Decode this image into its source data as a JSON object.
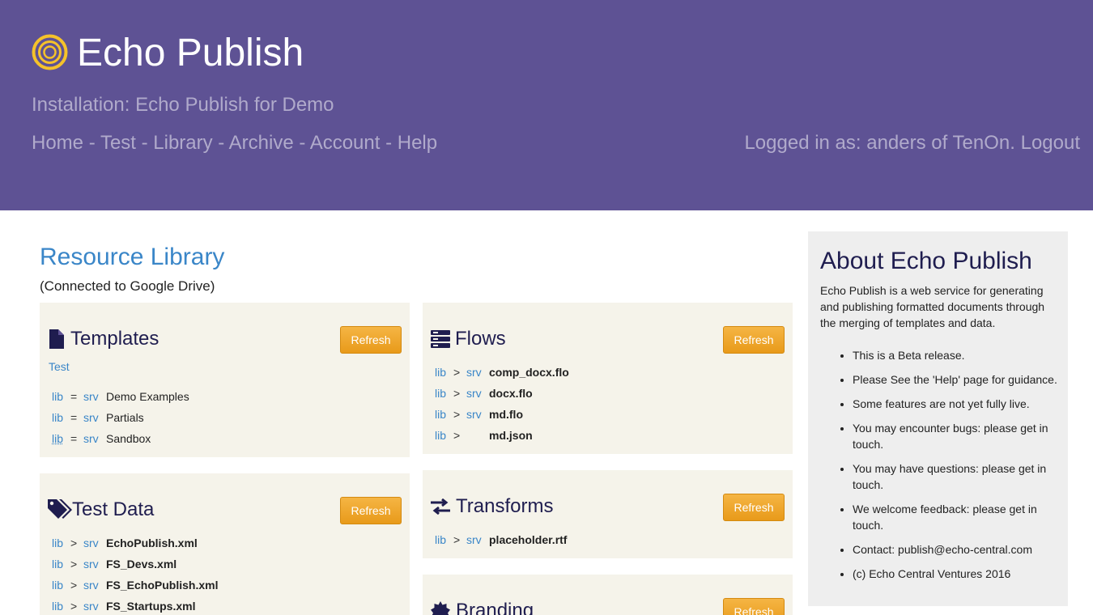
{
  "header": {
    "app_title": "Echo Publish",
    "installation": "Installation: Echo Publish for Demo",
    "nav": [
      "Home",
      "Test",
      "Library",
      "Archive",
      "Account",
      "Help"
    ],
    "nav_separator": " - ",
    "login_text": "Logged in as: anders of TenOn.",
    "logout_label": "Logout"
  },
  "library": {
    "title": "Resource Library",
    "subtitle": "(Connected to Google Drive)"
  },
  "refresh_label": "Refresh",
  "panels": {
    "templates": {
      "title": "Templates",
      "icon": "file-icon",
      "test_link": "Test",
      "rows": [
        {
          "a": "lib",
          "op": "=",
          "b": "srv",
          "name": "Demo Examples"
        },
        {
          "a": "lib",
          "op": "=",
          "b": "srv",
          "name": "Partials"
        },
        {
          "a": "lib",
          "op": "=",
          "b": "srv",
          "name": "Sandbox"
        }
      ]
    },
    "test_data": {
      "title": "Test Data",
      "icon": "tags-icon",
      "rows": [
        {
          "a": "lib",
          "op": ">",
          "b": "srv",
          "name": "EchoPublish.xml"
        },
        {
          "a": "lib",
          "op": ">",
          "b": "srv",
          "name": "FS_Devs.xml"
        },
        {
          "a": "lib",
          "op": ">",
          "b": "srv",
          "name": "FS_EchoPublish.xml"
        },
        {
          "a": "lib",
          "op": ">",
          "b": "srv",
          "name": "FS_Startups.xml"
        }
      ]
    },
    "flows": {
      "title": "Flows",
      "icon": "server-stack-icon",
      "rows": [
        {
          "a": "lib",
          "op": ">",
          "b": "srv",
          "name": "comp_docx.flo"
        },
        {
          "a": "lib",
          "op": ">",
          "b": "srv",
          "name": "docx.flo"
        },
        {
          "a": "lib",
          "op": ">",
          "b": "srv",
          "name": "md.flo"
        },
        {
          "a": "lib",
          "op": ">",
          "b": "",
          "name": "md.json"
        }
      ]
    },
    "transforms": {
      "title": "Transforms",
      "icon": "exchange-arrows-icon",
      "rows": [
        {
          "a": "lib",
          "op": ">",
          "b": "srv",
          "name": "placeholder.rtf"
        }
      ]
    },
    "branding": {
      "title": "Branding",
      "icon": "badge-icon"
    }
  },
  "about": {
    "title": "About Echo Publish",
    "description": "Echo Publish is a web service for generating and publishing formatted documents through the merging of templates and data.",
    "items": [
      "This is a Beta release.",
      "Please See the 'Help' page for guidance.",
      "Some features are not yet fully live.",
      "You may encounter bugs: please get in touch.",
      "You may have questions: please get in touch.",
      "We welcome feedback: please get in touch.",
      "Contact: publish@echo-central.com",
      "(c) Echo Central Ventures 2016"
    ]
  },
  "colors": {
    "header_bg": "#5e5294",
    "accent": "#3a86c8",
    "button": "#f0a830",
    "panel_bg": "#f5f3ea",
    "sidebar_bg": "#eeeeee",
    "logo": "#f5c22a"
  }
}
